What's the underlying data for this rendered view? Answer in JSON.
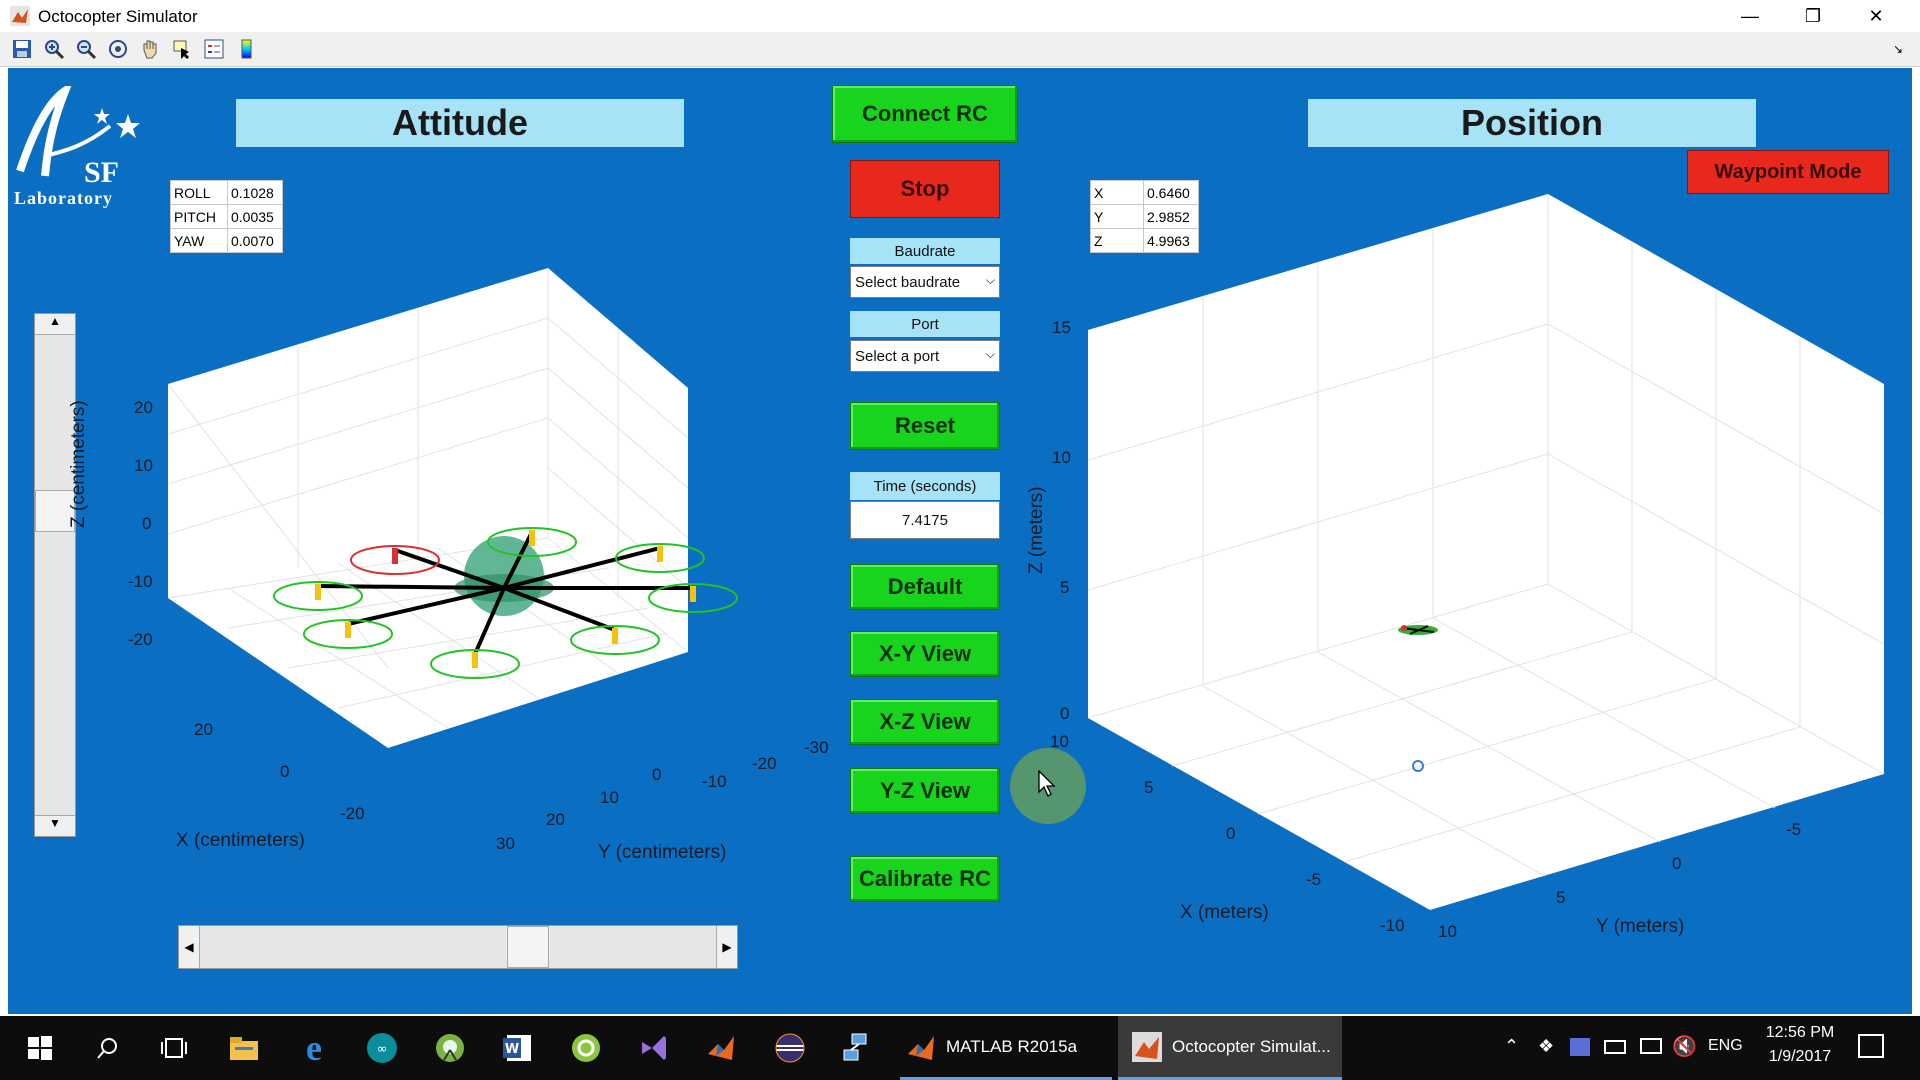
{
  "window": {
    "title": "Octocopter Simulator"
  },
  "toolbar": {
    "icons": [
      "save-icon",
      "zoom-in-icon",
      "zoom-out-icon",
      "rotate-icon",
      "pan-icon",
      "data-cursor-icon",
      "legend-icon",
      "colorbar-icon"
    ]
  },
  "logo": {
    "text_main": "SF",
    "text_sub": "Laboratory"
  },
  "attitude": {
    "title": "Attitude",
    "readout": [
      {
        "label": "ROLL",
        "value": "0.1028"
      },
      {
        "label": "PITCH",
        "value": "0.0035"
      },
      {
        "label": "YAW",
        "value": "0.0070"
      }
    ],
    "z_ticks": [
      "20",
      "10",
      "0",
      "-10",
      "-20"
    ],
    "x_ticks": [
      "20",
      "0",
      "-20"
    ],
    "y_ticks": [
      "30",
      "20",
      "10",
      "0",
      "-10",
      "-20",
      "-30"
    ],
    "xlabel": "X (centimeters)",
    "ylabel": "Y (centimeters)",
    "zlabel": "Z (centimeters)"
  },
  "controls": {
    "connect_rc": "Connect RC",
    "stop": "Stop",
    "baudrate_label": "Baudrate",
    "baudrate_value": "Select baudrate",
    "port_label": "Port",
    "port_value": "Select a port",
    "reset": "Reset",
    "time_label": "Time (seconds)",
    "time_value": "7.4175",
    "default": "Default",
    "xy_view": "X-Y View",
    "xz_view": "X-Z View",
    "yz_view": "Y-Z View",
    "calibrate_rc": "Calibrate RC"
  },
  "position": {
    "title": "Position",
    "waypoint_mode": "Waypoint Mode",
    "readout": [
      {
        "label": "X",
        "value": "0.6460"
      },
      {
        "label": "Y",
        "value": "2.9852"
      },
      {
        "label": "Z",
        "value": "4.9963"
      }
    ],
    "z_ticks": [
      "15",
      "10",
      "5",
      "0"
    ],
    "x_ticks": [
      "10",
      "5",
      "0",
      "-5",
      "-10"
    ],
    "y_ticks": [
      "10",
      "5",
      "0",
      "-5"
    ],
    "xlabel": "X (meters)",
    "ylabel": "Y (meters)",
    "zlabel": "Z (meters)"
  },
  "taskbar": {
    "matlab_label": "MATLAB R2015a",
    "sim_label": "Octocopter Simulat...",
    "lang": "ENG",
    "time": "12:56 PM",
    "date": "1/9/2017"
  },
  "colors": {
    "figure_bg": "#0a6fc2",
    "green_button": "#19d41d",
    "red_button": "#e8281c",
    "title_bg": "#a6e3f7"
  }
}
